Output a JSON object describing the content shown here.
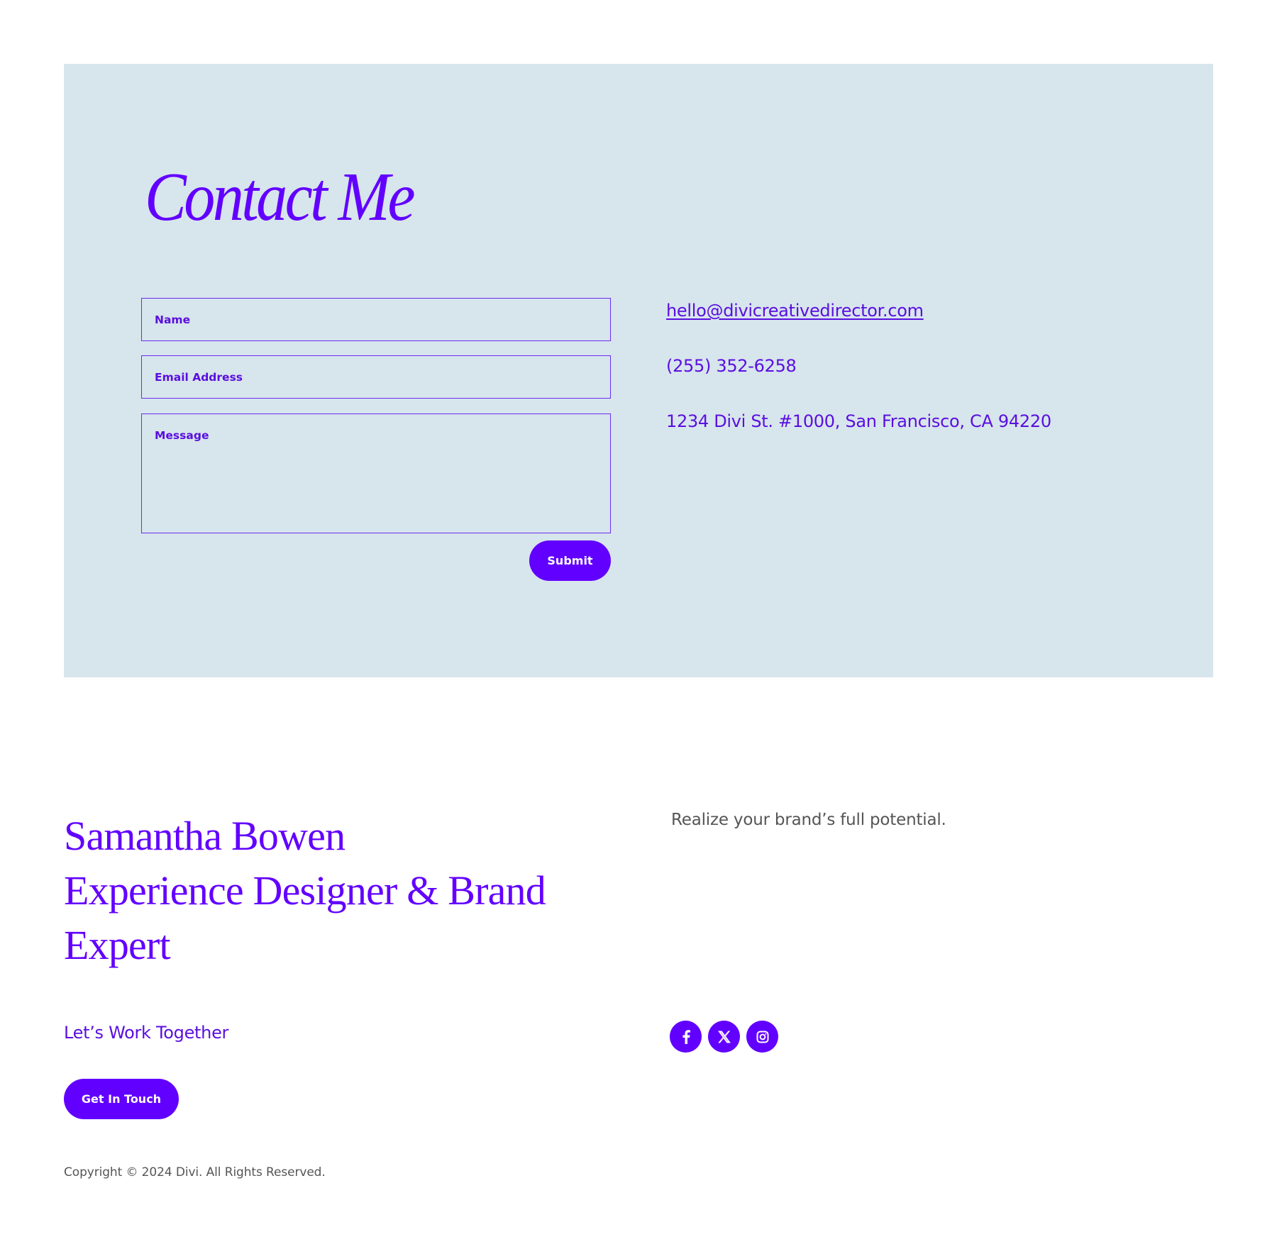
{
  "contact_section": {
    "title": "Contact Me",
    "form": {
      "name_placeholder": "Name",
      "name_value": "",
      "email_placeholder": "Email Address",
      "email_value": "",
      "message_placeholder": "Message",
      "message_value": "",
      "submit_label": "Submit"
    },
    "info": {
      "email": "hello@divicreativedirector.com",
      "phone": "(255) 352-6258",
      "address": "1234 Divi St. #1000, San Francisco, CA 94220"
    }
  },
  "footer": {
    "heading_lines": [
      "Samantha Bowen",
      "Experience Designer & Brand",
      "Expert"
    ],
    "tagline": "Realize your brand’s full potential.",
    "cta_text": "Let’s Work Together",
    "cta_button_label": "Get In Touch",
    "social_icons": [
      "facebook-icon",
      "x-twitter-icon",
      "instagram-icon"
    ],
    "copyright": "Copyright © 2024 Divi. All Rights Reserved."
  },
  "colors": {
    "accent": "#6200ff",
    "panel_background": "#d7e5ec",
    "muted_text": "#555555"
  }
}
